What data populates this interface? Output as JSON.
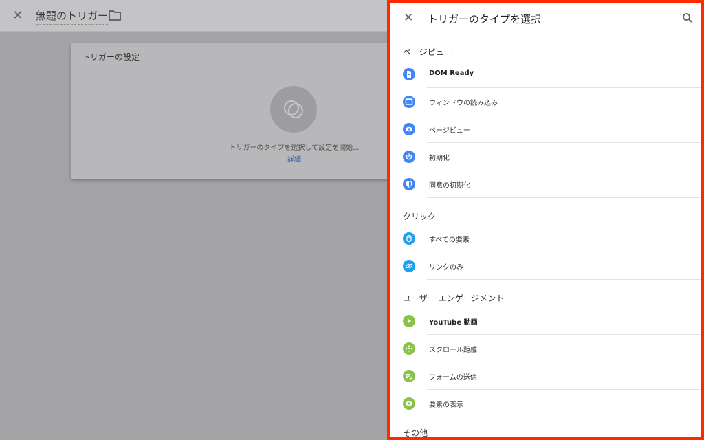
{
  "background": {
    "title": "無題のトリガー",
    "card_title": "トリガーの設定",
    "hint": "トリガーのタイプを選択して設定を開始...",
    "link": "詳細"
  },
  "panel": {
    "title": "トリガーのタイプを選択",
    "sections": {
      "pageview": "ページビュー",
      "click": "クリック",
      "engagement": "ユーザー エンゲージメント",
      "other": "その他"
    },
    "items": {
      "dom_ready": "DOM Ready",
      "window_load": "ウィンドウの読み込み",
      "page_view": "ページビュー",
      "initialization": "初期化",
      "consent_init": "同意の初期化",
      "all_elements": "すべての要素",
      "just_links": "リンクのみ",
      "youtube": "YouTube 動画",
      "scroll_depth": "スクロール距離",
      "form_submit": "フォームの送信",
      "element_visibility": "要素の表示"
    }
  },
  "colors": {
    "blue": "#4285f4",
    "light_blue": "#1fa2ee",
    "green": "#8bc34a",
    "highlight_border": "#ff2a00"
  }
}
